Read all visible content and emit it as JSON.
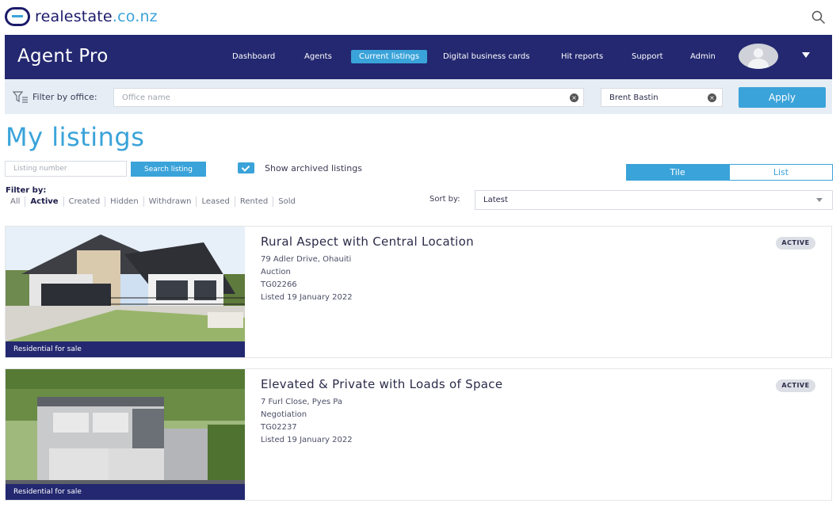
{
  "header": {
    "logo_text": "realestate",
    "logo_tld": ".co.nz"
  },
  "navbar": {
    "brand": "Agent Pro",
    "items": [
      {
        "label": "Dashboard"
      },
      {
        "label": "Agents"
      },
      {
        "label": "Current listings",
        "active": true
      },
      {
        "label": "Digital business cards"
      },
      {
        "label": "Hit reports"
      },
      {
        "label": "Support"
      },
      {
        "label": "Admin"
      }
    ]
  },
  "filter_bar": {
    "label": "Filter by office:",
    "office_placeholder": "Office name",
    "agent_value": "Brent Bastin",
    "apply_label": "Apply"
  },
  "page": {
    "title": "My listings",
    "listing_placeholder": "Listing number",
    "search_label": "Search listing",
    "archived_label": "Show archived listings",
    "archived_checked": true,
    "view_tile": "Tile",
    "view_list": "List",
    "filter_label": "Filter by:",
    "status_tabs": [
      "All",
      "Active",
      "Created",
      "Hidden",
      "Withdrawn",
      "Leased",
      "Rented",
      "Sold"
    ],
    "active_status": "Active",
    "sort_label": "Sort by:",
    "sort_value": "Latest"
  },
  "listings": [
    {
      "title": "Rural Aspect with Central Location",
      "address": "79 Adler Drive, Ohauiti",
      "method": "Auction",
      "ref": "TG02266",
      "listed": "Listed 19 January 2022",
      "status": "ACTIVE",
      "category": "Residential for sale"
    },
    {
      "title": "Elevated & Private with Loads of Space",
      "address": "7 Furl Close, Pyes Pa",
      "method": "Negotiation",
      "ref": "TG02237",
      "listed": "Listed 19 January 2022",
      "status": "ACTIVE",
      "category": "Residential for sale"
    }
  ],
  "colors": {
    "navy": "#232870",
    "accent": "#3aa3d9",
    "filter_bg": "#e6edf5"
  }
}
